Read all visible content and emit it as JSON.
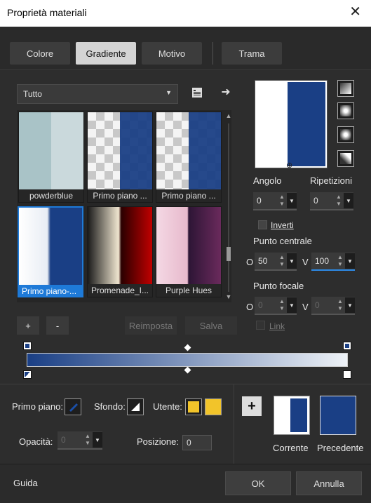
{
  "window": {
    "title": "Proprietà materiali",
    "close_glyph": "✕"
  },
  "tabs": [
    {
      "label": "Colore"
    },
    {
      "label": "Gradiente"
    },
    {
      "label": "Motivo"
    },
    {
      "label": "Trama"
    }
  ],
  "category": {
    "selected": "Tutto"
  },
  "gallery": {
    "items": [
      {
        "label": "powderblue"
      },
      {
        "label": "Primo piano ..."
      },
      {
        "label": "Primo piano ..."
      },
      {
        "label": "Primo piano-..."
      },
      {
        "label": "Promenade_I..."
      },
      {
        "label": "Purple Hues"
      }
    ]
  },
  "buttons": {
    "add": "+",
    "remove": "-",
    "reset": "Reimposta",
    "save": "Salva"
  },
  "settings": {
    "angle_label": "Angolo",
    "angle_value": "0",
    "repeat_label": "Ripetizioni",
    "repeat_value": "0",
    "invert_label": "Inverti",
    "center_label": "Punto centrale",
    "center_o_label": "O",
    "center_o_value": "50",
    "center_v_label": "V",
    "center_v_value": "100",
    "focal_label": "Punto focale",
    "focal_o_label": "O",
    "focal_o_value": "0",
    "focal_v_label": "V",
    "focal_v_value": "0",
    "link_label": "Link"
  },
  "bottom": {
    "foreground_label": "Primo piano:",
    "background_label": "Sfondo:",
    "user_label": "Utente:",
    "opacity_label": "Opacità:",
    "opacity_value": "0",
    "position_label": "Posizione:",
    "position_value": "0",
    "current_label": "Corrente",
    "previous_label": "Precedente",
    "add_glyph": "+"
  },
  "footer": {
    "help": "Guida",
    "ok": "OK",
    "cancel": "Annulla"
  },
  "colors": {
    "gradient_blue": "#1a3f85",
    "user_yellow": "#f2c42a",
    "selection": "#1e7ad8"
  }
}
